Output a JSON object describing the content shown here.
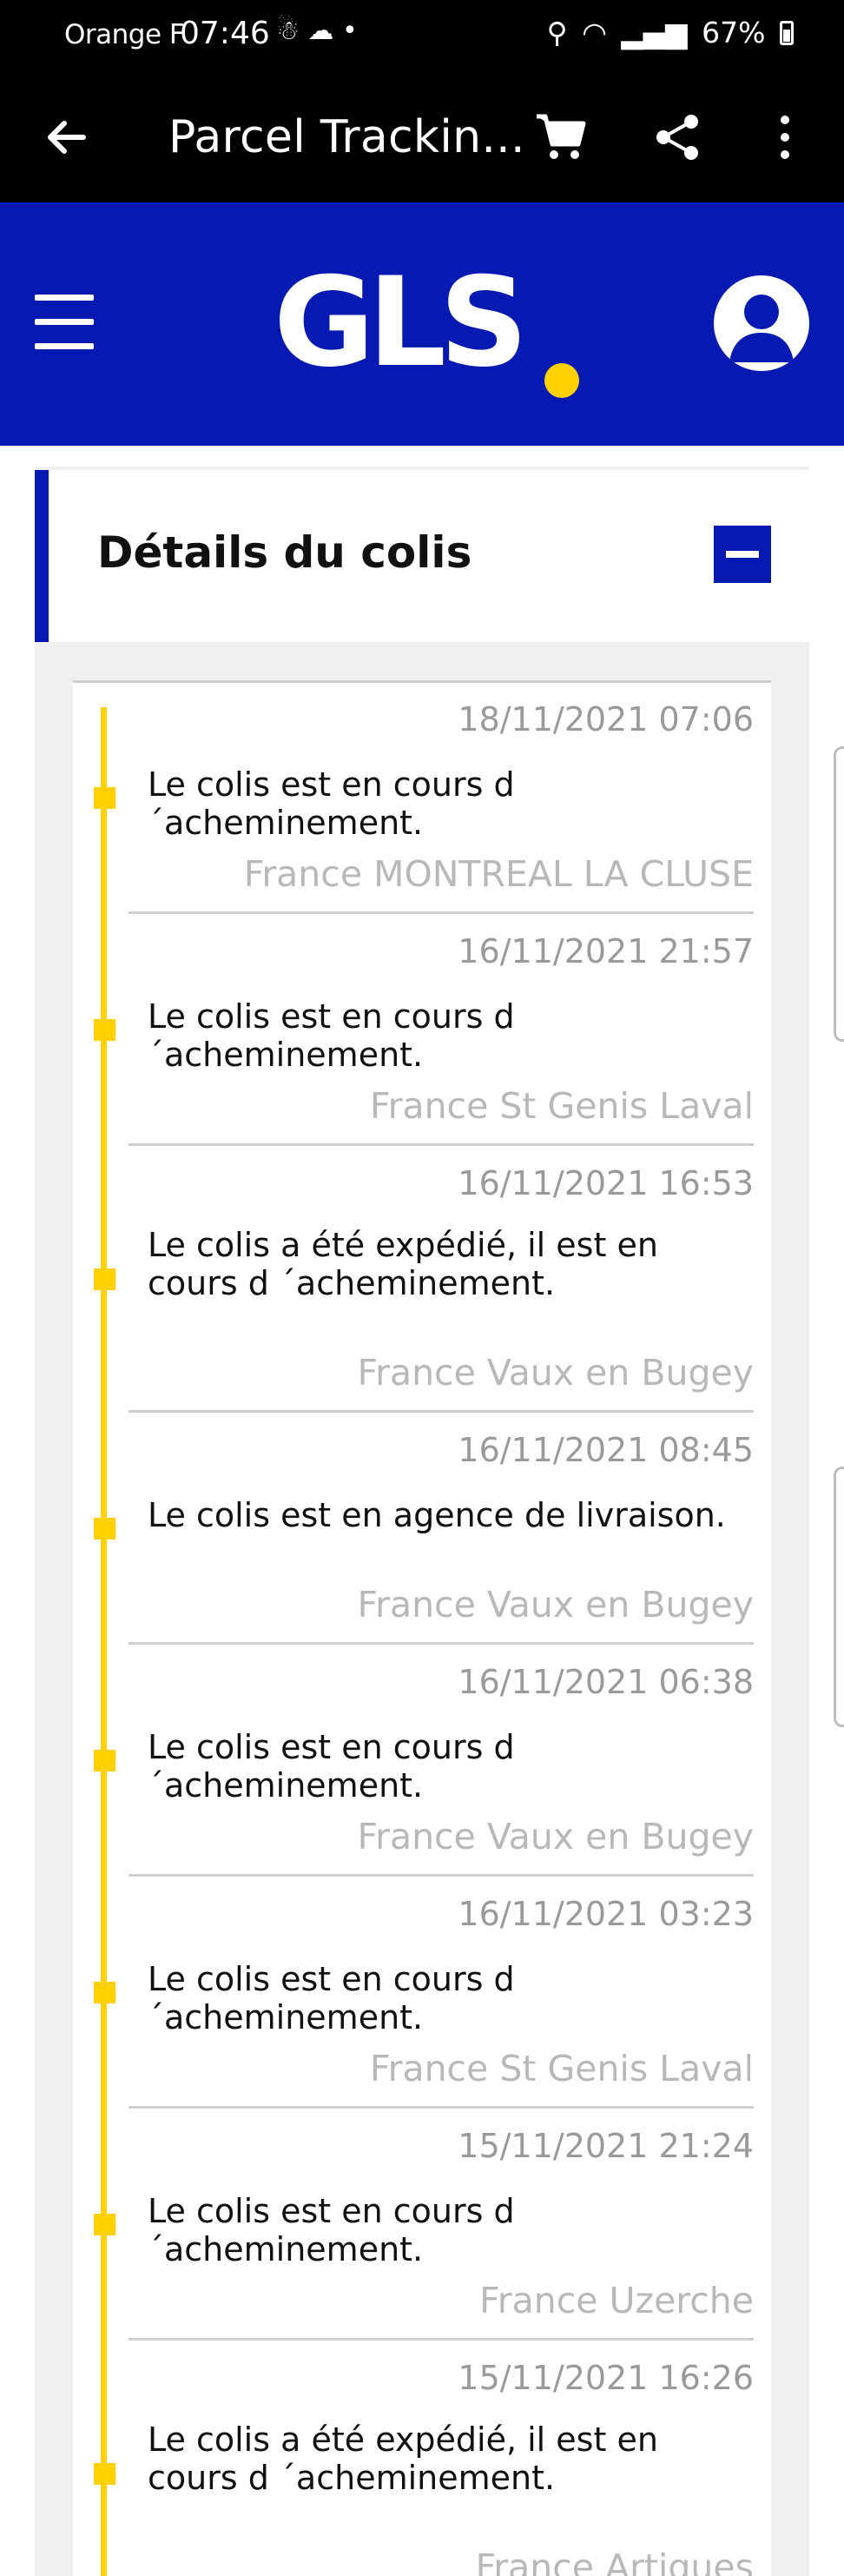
{
  "status_bar": {
    "carrier": "Orange F",
    "time": "07:46",
    "notif_icons": "☃ ☁ •",
    "battery": "67%"
  },
  "app_bar": {
    "title": "Parcel Trackin..."
  },
  "header": {
    "logo_text": "GLS",
    "brand_color": "#061ab1",
    "accent_color": "#ffd100"
  },
  "details": {
    "title": "Détails du colis"
  },
  "events": [
    {
      "date": "18/11/2021 07:06",
      "message": "Le colis est en cours d´acheminement.",
      "location": "France MONTREAL LA CLUSE"
    },
    {
      "date": "16/11/2021 21:57",
      "message": "Le colis est en cours d´acheminement.",
      "location": "France St Genis Laval"
    },
    {
      "date": "16/11/2021 16:53",
      "message": "Le colis a été expédié, il est en cours d ´acheminement.",
      "location": "France Vaux en Bugey"
    },
    {
      "date": "16/11/2021 08:45",
      "message": "Le colis est en agence de livraison.",
      "location": "France Vaux en Bugey"
    },
    {
      "date": "16/11/2021 06:38",
      "message": "Le colis est en cours d´acheminement.",
      "location": "France Vaux en Bugey"
    },
    {
      "date": "16/11/2021 03:23",
      "message": "Le colis est en cours d´acheminement.",
      "location": "France St Genis Laval"
    },
    {
      "date": "15/11/2021 21:24",
      "message": "Le colis est en cours d´acheminement.",
      "location": "France Uzerche"
    },
    {
      "date": "15/11/2021 16:26",
      "message": "Le colis a été expédié, il est en cours d ´acheminement.",
      "location": "France Artigues"
    }
  ]
}
